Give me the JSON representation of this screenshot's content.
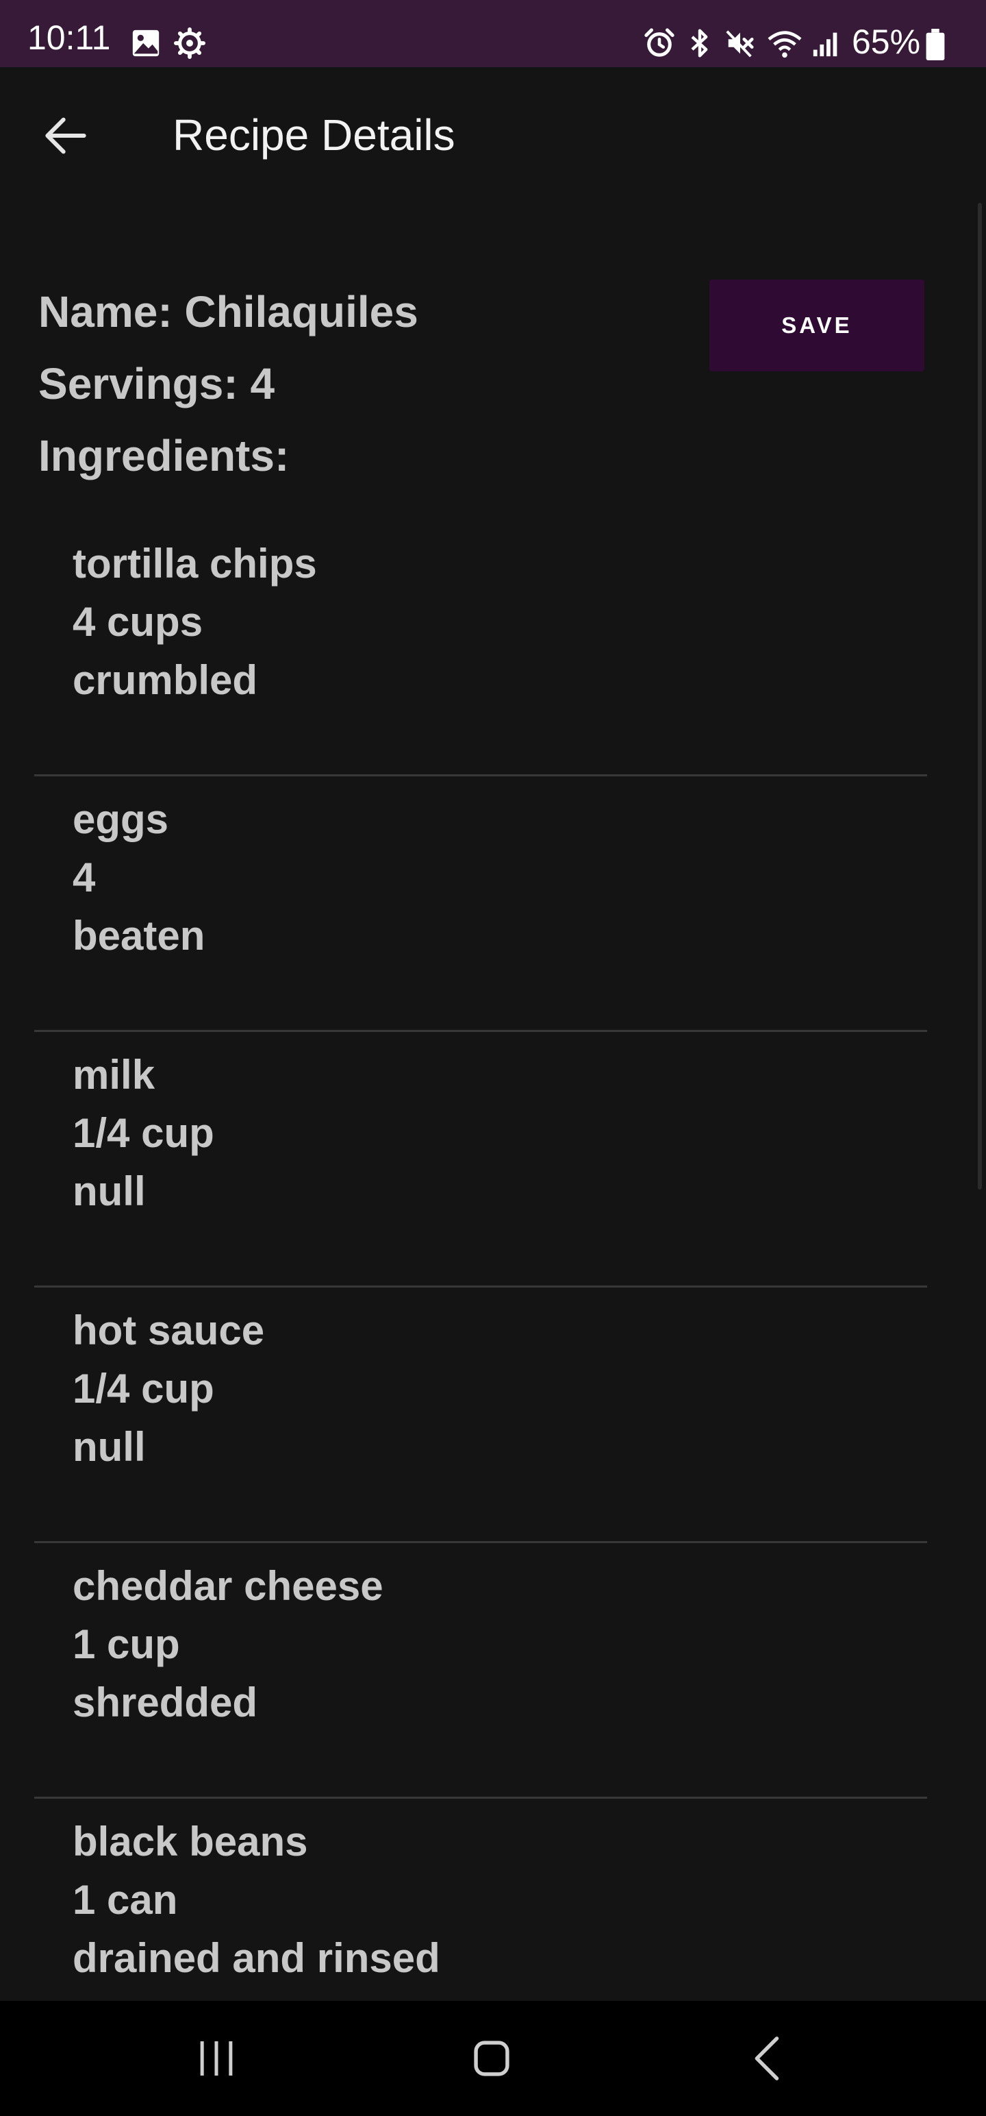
{
  "status_bar": {
    "time": "10:11",
    "battery": "65%",
    "background_color": "#361a38",
    "icons": [
      "gallery-icon",
      "settings-icon",
      "alarm-icon",
      "bluetooth-icon",
      "mute-icon",
      "wifi-icon",
      "signal-icon",
      "battery-icon"
    ]
  },
  "app_bar": {
    "title": "Recipe Details",
    "back_icon": "arrow-left-icon"
  },
  "recipe": {
    "name_line": "Name: Chilaquiles",
    "servings_line": "Servings: 4",
    "ingredients_label": "Ingredients:",
    "save_label": "SAVE",
    "save_color": "#2f0a33"
  },
  "ingredients": [
    {
      "name": "tortilla chips",
      "quantity": "4 cups",
      "preparation": "crumbled"
    },
    {
      "name": "eggs",
      "quantity": "4",
      "preparation": "beaten"
    },
    {
      "name": "milk",
      "quantity": "1/4 cup",
      "preparation": "null"
    },
    {
      "name": "hot sauce",
      "quantity": "1/4 cup",
      "preparation": "null"
    },
    {
      "name": "cheddar cheese",
      "quantity": "1 cup",
      "preparation": "shredded"
    },
    {
      "name": "black beans",
      "quantity": "1 can",
      "preparation": "drained and rinsed"
    }
  ],
  "nav_bar": {
    "buttons": [
      "recent-apps-icon",
      "home-icon",
      "back-icon"
    ]
  }
}
